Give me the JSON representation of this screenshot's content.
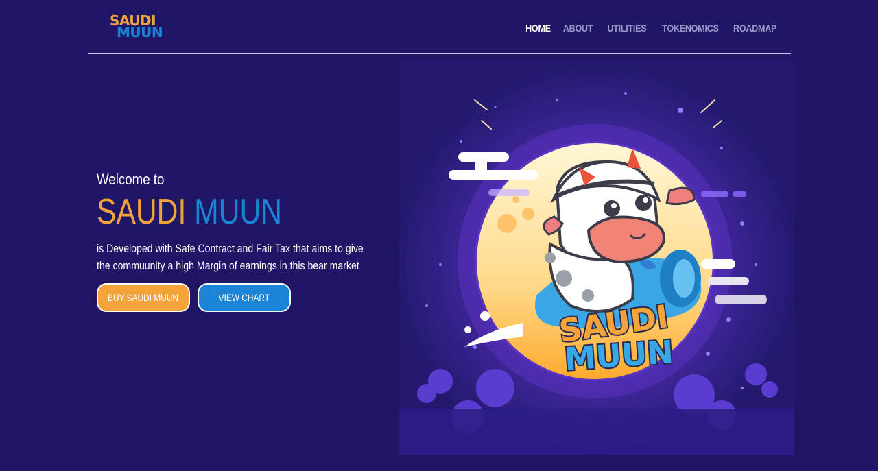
{
  "brand": {
    "logo_line1": "SAUDI",
    "logo_line2": "MUUN"
  },
  "nav": {
    "items": [
      {
        "label": "HOME",
        "active": true
      },
      {
        "label": "ABOUT",
        "active": false
      },
      {
        "label": "UTILITIES",
        "active": false
      },
      {
        "label": "TOKENOMICS",
        "active": false
      },
      {
        "label": "ROADMAP",
        "active": false
      }
    ]
  },
  "hero": {
    "welcome": "Welcome to",
    "title_part1": "SAUDI",
    "title_part2": "MUUN",
    "description": "is Developed with Safe Contract and Fair Tax that aims to give the commuunity a high Margin of earnings in this bear market",
    "buy_button": "BUY SAUDI MUUN",
    "chart_button": "VIEW CHART"
  },
  "illustration": {
    "text_line1": "SAUDI",
    "text_line2": "MUUN"
  },
  "colors": {
    "background": "#1f1766",
    "orange": "#f3a33a",
    "blue": "#1c84d6",
    "nav_inactive": "#9a98c8"
  }
}
